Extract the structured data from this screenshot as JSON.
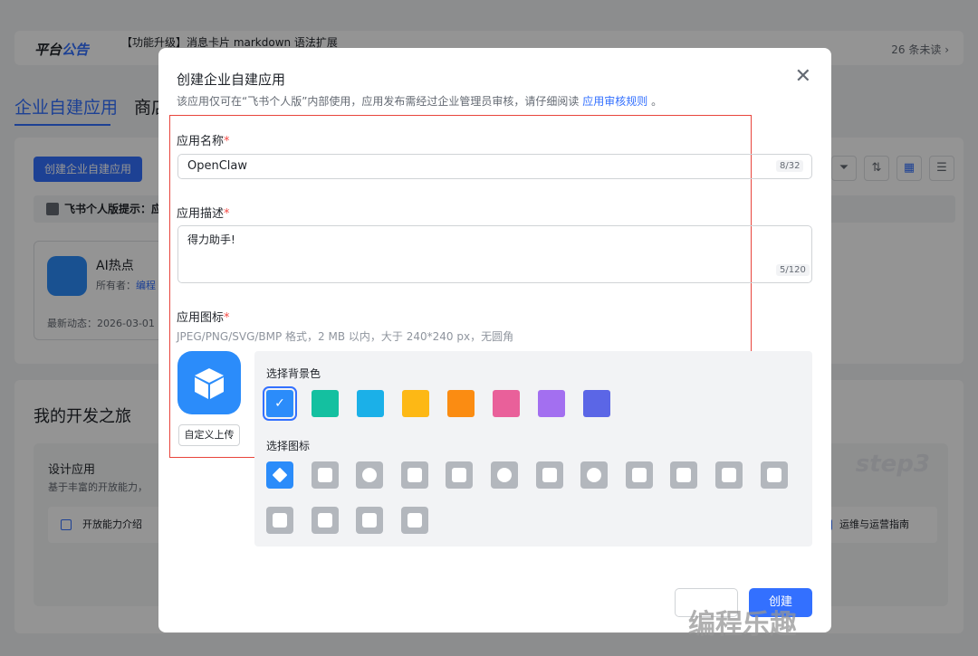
{
  "background": {
    "announcement": {
      "label_a": "平台",
      "label_b": "公告",
      "message": "【功能升级】消息卡片 markdown 语法扩展",
      "unread": "26 条未读 ›"
    },
    "tabs": [
      {
        "label": "企业自建应用",
        "active": true
      },
      {
        "label": "商店"
      }
    ],
    "create_button": "创建企业自建应用",
    "tip": "飞书个人版提示：应",
    "app_card": {
      "name": "AI热点",
      "owner_label": "所有者：",
      "owner": "编程",
      "updated": "最新动态：2026-03-01"
    },
    "journey": {
      "title": "我的开发之旅",
      "panel_title": "设计应用",
      "panel_subtitle": "基于丰富的开放能力，",
      "link_left": "开放能力介绍",
      "link_right": "运维与运营指南",
      "step": "step3"
    }
  },
  "modal": {
    "title": "创建企业自建应用",
    "close_icon": "close-icon",
    "description": "该应用仅可在“飞书个人版”内部使用，应用发布需经过企业管理员审核，请仔细阅读",
    "description_link": "应用审核规则",
    "description_end": "。",
    "name_label": "应用名称",
    "name_value": "OpenClaw",
    "name_count": "8/32",
    "desc_label": "应用描述",
    "desc_value": "得力助手!",
    "desc_count": "5/120",
    "icon_label": "应用图标",
    "required_mark": "*",
    "icon_hint": "JPEG/PNG/SVG/BMP 格式，2 MB 以内，大于 240*240 px，无圆角",
    "upload_button": "自定义上传",
    "bg_color_label": "选择背景色",
    "colors": [
      "#2b8cfa",
      "#14c0a0",
      "#1bb0e8",
      "#fdb815",
      "#fb8c12",
      "#e9609a",
      "#a36ff0",
      "#5b66e6"
    ],
    "selected_color": 0,
    "icon_select_label": "选择图标",
    "icons": [
      "cube-icon",
      "robot-icon",
      "lightbulb-icon",
      "chart-icon",
      "briefcase-icon",
      "bell-icon",
      "checklist-icon",
      "pie-chart-icon",
      "star-icon",
      "tag-icon",
      "wrench-icon",
      "document-icon",
      "shield-icon",
      "layout-icon",
      "people-icon",
      "code-icon"
    ],
    "selected_icon": 0,
    "cancel_button": "",
    "confirm_button": "创建"
  },
  "watermark": "编程乐趣"
}
